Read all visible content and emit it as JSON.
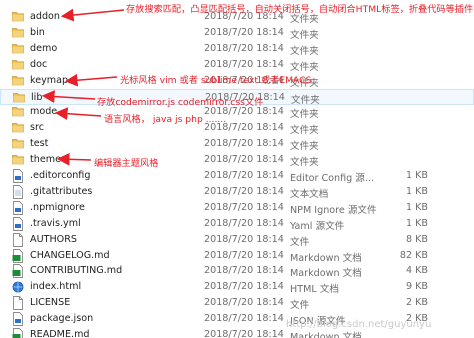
{
  "files": [
    {
      "name": "addon",
      "date": "2018/7/20 18:14",
      "type": "文件夹",
      "size": "",
      "icon": "folder-icon"
    },
    {
      "name": "bin",
      "date": "2018/7/20 18:14",
      "type": "文件夹",
      "size": "",
      "icon": "folder-icon"
    },
    {
      "name": "demo",
      "date": "2018/7/20 18:14",
      "type": "文件夹",
      "size": "",
      "icon": "folder-icon"
    },
    {
      "name": "doc",
      "date": "2018/7/20 18:14",
      "type": "文件夹",
      "size": "",
      "icon": "folder-icon"
    },
    {
      "name": "keymap",
      "date": "2018/7/20 18:14",
      "type": "文件夹",
      "size": "",
      "icon": "folder-icon"
    },
    {
      "name": "lib",
      "date": "2018/7/20 18:14",
      "type": "文件夹",
      "size": "",
      "icon": "folder-icon"
    },
    {
      "name": "mode",
      "date": "2018/7/20 18:14",
      "type": "文件夹",
      "size": "",
      "icon": "folder-icon"
    },
    {
      "name": "src",
      "date": "2018/7/20 18:14",
      "type": "文件夹",
      "size": "",
      "icon": "folder-icon"
    },
    {
      "name": "test",
      "date": "2018/7/20 18:14",
      "type": "文件夹",
      "size": "",
      "icon": "folder-icon"
    },
    {
      "name": "theme",
      "date": "2018/7/20 18:14",
      "type": "文件夹",
      "size": "",
      "icon": "folder-icon"
    },
    {
      "name": ".editorconfig",
      "date": "2018/7/20 18:14",
      "type": "Editor Config 源...",
      "size": "1 KB",
      "icon": "config-file-icon"
    },
    {
      "name": ".gitattributes",
      "date": "2018/7/20 18:14",
      "type": "文本文档",
      "size": "1 KB",
      "icon": "text-file-icon"
    },
    {
      "name": ".npmignore",
      "date": "2018/7/20 18:14",
      "type": "NPM Ignore 源文件",
      "size": "1 KB",
      "icon": "config-file-icon"
    },
    {
      "name": ".travis.yml",
      "date": "2018/7/20 18:14",
      "type": "Yaml 源文件",
      "size": "1 KB",
      "icon": "config-file-icon"
    },
    {
      "name": "AUTHORS",
      "date": "2018/7/20 18:14",
      "type": "文件",
      "size": "8 KB",
      "icon": "file-icon"
    },
    {
      "name": "CHANGELOG.md",
      "date": "2018/7/20 18:14",
      "type": "Markdown 文档",
      "size": "82 KB",
      "icon": "markdown-file-icon"
    },
    {
      "name": "CONTRIBUTING.md",
      "date": "2018/7/20 18:14",
      "type": "Markdown 文档",
      "size": "4 KB",
      "icon": "markdown-file-icon"
    },
    {
      "name": "index.html",
      "date": "2018/7/20 18:14",
      "type": "HTML 文档",
      "size": "9 KB",
      "icon": "html-file-icon"
    },
    {
      "name": "LICENSE",
      "date": "2018/7/20 18:14",
      "type": "文件",
      "size": "2 KB",
      "icon": "file-icon"
    },
    {
      "name": "package.json",
      "date": "2018/7/20 18:14",
      "type": "JSON 源文件",
      "size": "2 KB",
      "icon": "config-file-icon"
    },
    {
      "name": "README.md",
      "date": "2018/7/20 18:14",
      "type": "Markdown 文档",
      "size": "",
      "icon": "markdown-file-icon"
    }
  ],
  "annotations": {
    "addon": "存放搜索匹配，凸显匹配括号，自动关闭括号，自动闭合HTML标签，折叠代码等插件",
    "keymap": "光标风格 vim 或者 sublime text 或者EMACS",
    "lib": "存放codemirror.js codemirror.css文件",
    "mode": "语言风格， java js  php .......",
    "theme": "编辑器主题风格"
  },
  "watermark": "http://blog.csdn.net/guyunyu",
  "colors": {
    "annotation": "#e8202a",
    "folder": "#e8c05a",
    "highlight": "#f2f8fd"
  }
}
